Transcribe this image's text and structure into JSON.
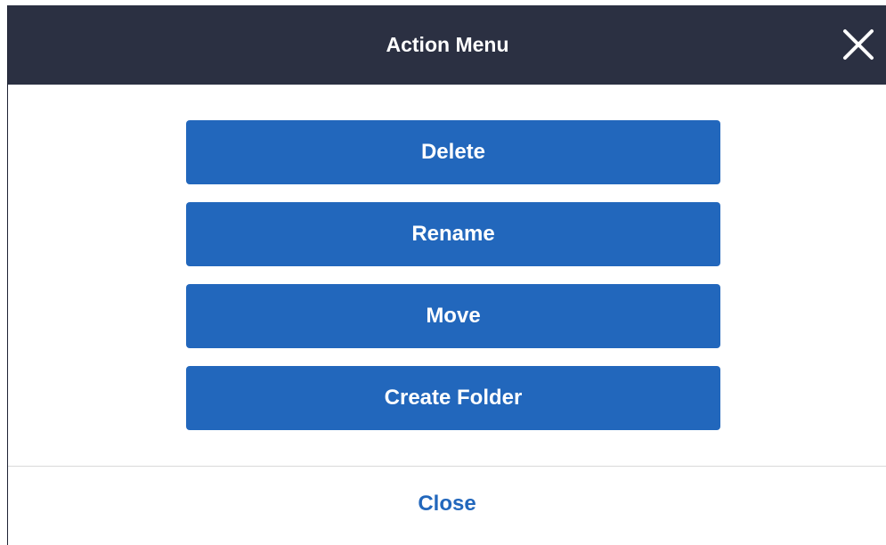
{
  "dialog": {
    "title": "Action Menu",
    "close_icon": "close-icon",
    "actions": [
      {
        "label": "Delete"
      },
      {
        "label": "Rename"
      },
      {
        "label": "Move"
      },
      {
        "label": "Create Folder"
      }
    ],
    "footer_close_label": "Close"
  },
  "colors": {
    "header_bg": "#2b3042",
    "button_bg": "#2267bc",
    "link": "#2267bc"
  }
}
